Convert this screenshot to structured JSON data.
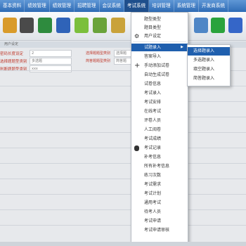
{
  "menubar": {
    "items": [
      "基本资料",
      "绩效管理",
      "绩效管理",
      "招聘管理",
      "会议系统",
      "考试系统",
      "培训管理",
      "系统管理",
      "开发商系统"
    ]
  },
  "toolbar": {
    "icons": [
      "folder-icon",
      "calculator-icon",
      "excel-icon",
      "word-icon",
      "chart-icon",
      "edit-icon",
      "save-icon",
      "refresh-icon",
      "search-icon"
    ],
    "colors": [
      "#d99b2b",
      "#4a4a4a",
      "#2e8b3e",
      "#2f63b8",
      "#7bbf3c",
      "#6aa33a",
      "#4f86c6",
      "#2aa33c",
      "#3566c8"
    ]
  },
  "panel": {
    "title": "用户设定"
  },
  "form": {
    "rows": [
      {
        "label": "密码长度设定",
        "value": "2",
        "label2": "选择题题型类别",
        "value2": "选择题"
      },
      {
        "label": "选择题题型类别",
        "value": "多选题",
        "label2": "简答题题型类别",
        "value2": "简答题"
      },
      {
        "label": "判断题题型类别",
        "value": "xxx",
        "label2": "",
        "value2": ""
      }
    ]
  },
  "dropdown": {
    "items": [
      {
        "label": "题型类型",
        "icon": ""
      },
      {
        "label": "题目类型",
        "icon": ""
      },
      {
        "label": "用户设定",
        "icon": "gear"
      },
      {
        "label": "试题录入",
        "icon": "",
        "submenu": true
      },
      {
        "label": "答案导入",
        "icon": ""
      },
      {
        "label": "手动添加试卷",
        "icon": "plus"
      },
      {
        "label": "自动生成试卷",
        "icon": ""
      },
      {
        "label": "试卷信息",
        "icon": ""
      },
      {
        "label": "考试录入",
        "icon": ""
      },
      {
        "label": "考试安排",
        "icon": ""
      },
      {
        "label": "在线考试",
        "icon": ""
      },
      {
        "label": "评卷人员",
        "icon": ""
      },
      {
        "label": "人工阅卷",
        "icon": ""
      },
      {
        "label": "考试成绩",
        "icon": ""
      },
      {
        "label": "考试记录",
        "icon": "database"
      },
      {
        "label": "补考信息",
        "icon": ""
      },
      {
        "label": "所有补考信息",
        "icon": ""
      },
      {
        "label": "练习次数",
        "icon": ""
      },
      {
        "label": "考试需求",
        "icon": ""
      },
      {
        "label": "考试计划",
        "icon": ""
      },
      {
        "label": "通用考试",
        "icon": ""
      },
      {
        "label": "待考人员",
        "icon": ""
      },
      {
        "label": "考试申请",
        "icon": ""
      },
      {
        "label": "考试申请审核",
        "icon": ""
      }
    ]
  },
  "submenu": {
    "items": [
      "选择题录入",
      "多选题录入",
      "填空题录入",
      "简答题录入"
    ]
  }
}
